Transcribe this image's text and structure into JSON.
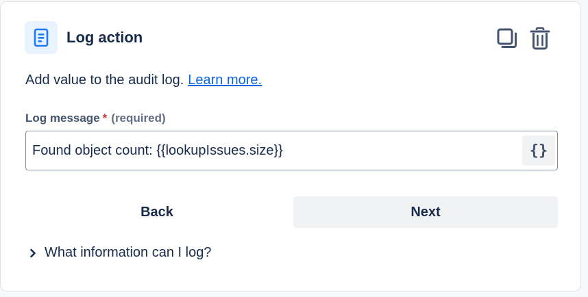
{
  "header": {
    "title": "Log action",
    "icon": "document-icon",
    "actions": [
      {
        "name": "duplicate",
        "icon": "copy-icon"
      },
      {
        "name": "delete",
        "icon": "trash-icon"
      }
    ]
  },
  "description": {
    "text": "Add value to the audit log.",
    "link_label": "Learn more."
  },
  "field": {
    "label": "Log message",
    "required_mark": "*",
    "required_text": "(required)",
    "value": "Found object count: {{lookupIssues.size}}",
    "smart_value_button": "{}"
  },
  "buttons": {
    "back": "Back",
    "next": "Next"
  },
  "expander": {
    "label": "What information can I log?",
    "icon": "chevron-right-icon"
  },
  "colors": {
    "link": "#0c66e4",
    "required": "#c9372c",
    "icon_tile": "#e9f2ff",
    "icon_blue": "#1d7afc",
    "text": "#172b4d"
  }
}
